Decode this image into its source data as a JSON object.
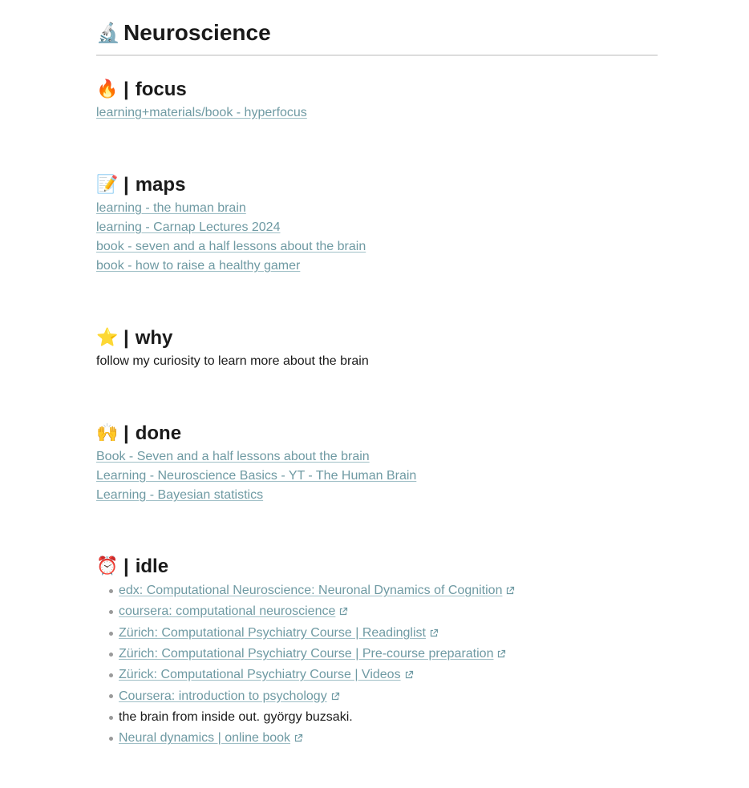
{
  "page": {
    "title_icon": "🔬",
    "title": "Neuroscience"
  },
  "focus": {
    "icon": "🔥",
    "separator": "|",
    "label": "focus",
    "links": [
      "learning+materials/book - hyperfocus"
    ]
  },
  "maps": {
    "icon": "📝",
    "separator": "|",
    "label": "maps",
    "links": [
      "learning - the human brain",
      "learning - Carnap Lectures 2024",
      "book - seven and a half lessons about the brain",
      "book - how to raise a healthy gamer"
    ]
  },
  "why": {
    "icon": "⭐",
    "separator": "|",
    "label": "why",
    "text": "follow my curiosity to learn more about the brain"
  },
  "done": {
    "icon": "🙌",
    "separator": "|",
    "label": "done",
    "links": [
      "Book - Seven and a half lessons about the brain",
      "Learning - Neuroscience Basics - YT - The Human Brain",
      "Learning - Bayesian statistics"
    ]
  },
  "idle": {
    "icon": "⏰",
    "separator": "|",
    "label": "idle",
    "items": [
      {
        "text": "edx: Computational Neuroscience: Neuronal Dynamics of Cognition",
        "external": true
      },
      {
        "text": "coursera: computational neuroscience",
        "external": true
      },
      {
        "text": "Zürich: Computational Psychiatry Course | Readinglist",
        "external": true
      },
      {
        "text": "Zürich: Computational Psychiatry Course | Pre-course preparation",
        "external": true
      },
      {
        "text": "Zürick: Computational Psychiatry Course | Videos",
        "external": true
      },
      {
        "text": "Coursera: introduction to psychology",
        "external": true
      },
      {
        "text": "the brain from inside out. györgy buzsaki.",
        "external": false
      },
      {
        "text": "Neural dynamics | online book",
        "external": true
      }
    ]
  },
  "colors": {
    "link": "#6f9aa3",
    "text": "#1a1a1a",
    "divider": "#dcdcdc",
    "bullet": "#9a9a9a"
  },
  "icons": {
    "external": "external-link-icon"
  }
}
